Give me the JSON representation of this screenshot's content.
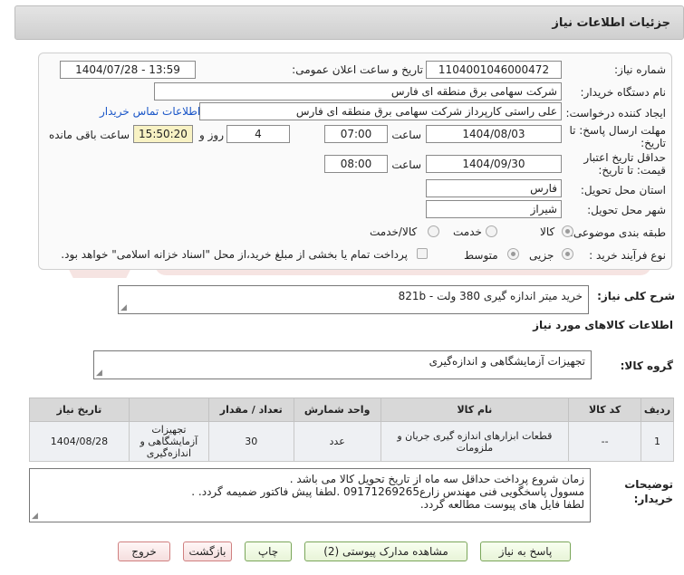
{
  "header": {
    "title": "جزئیات اطلاعات نیاز"
  },
  "form": {
    "need_number_label": "شماره نیاز:",
    "need_number": "1104001046000472",
    "announce_label": "تاریخ و ساعت اعلان عمومی:",
    "announce_value": "1404/07/28 - 13:59",
    "buyer_org_label": "نام دستگاه خریدار:",
    "buyer_org": "شرکت سهامی برق منطقه ای فارس",
    "creator_label": "ایجاد کننده درخواست:",
    "creator": "علی راستی کارپرداز شرکت سهامی برق منطقه ای فارس",
    "contact_link": "اطلاعات تماس خریدار",
    "deadline_label_1": "مهلت ارسال پاسخ: تا",
    "deadline_label_2": "تاریخ:",
    "deadline_date": "1404/08/03",
    "time_label": "ساعت",
    "deadline_time": "07:00",
    "days_value": "4",
    "days_label": "روز و",
    "remaining_time": "15:50:20",
    "remaining_label": "ساعت باقی مانده",
    "min_validity_label_1": "حداقل تاریخ اعتبار",
    "min_validity_label_2": "قیمت: تا تاریخ:",
    "validity_date": "1404/09/30",
    "validity_time": "08:00",
    "province_label": "استان محل تحویل:",
    "province": "فارس",
    "city_label": "شهر محل تحویل:",
    "city": "شیراز",
    "category_label": "طبقه بندی موضوعی:",
    "category_options": [
      "کالا",
      "خدمت",
      "کالا/خدمت"
    ],
    "process_label": "نوع فرآیند خرید :",
    "process_options": [
      "جزیی",
      "متوسط"
    ],
    "payment_note": "پرداخت تمام یا بخشی از مبلغ خرید،از محل \"اسناد خزانه اسلامی\" خواهد بود."
  },
  "summary": {
    "label": "شرح کلی نیاز:",
    "value": "خرید میتر اندازه گیری 380 ولت - 821b"
  },
  "goods_info": {
    "heading": "اطلاعات کالاهای مورد نیاز",
    "group_label": "گروه کالا:",
    "group_value": "تجهیزات آزمایشگاهی و اندازه‌گیری"
  },
  "table": {
    "headers": [
      "ردیف",
      "کد کالا",
      "نام کالا",
      "واحد شمارش",
      "تعداد / مقدار",
      "تاریخ نیاز"
    ],
    "rows": [
      {
        "row": "1",
        "code": "--",
        "name": "قطعات ابزارهای اندازه گیری جریان و ملزومات",
        "unit": "عدد",
        "qty": "30",
        "need_date": "1404/08/28",
        "group_1": "تجهیزات",
        "group_2": "آزمایشگاهی و",
        "group_3": "اندازه‌گیری"
      }
    ]
  },
  "notes": {
    "label_1": "توضیحات",
    "label_2": "خریدار:",
    "line_1": "زمان شروع پرداخت حداقل سه ماه از تاریخ تحویل کالا می باشد .",
    "line_2": "مسوول پاسخگویی فنی مهندس زارع09171269265 .لطفا پیش فاکتور ضمیمه گردد. .",
    "line_3": "لطفا فایل های پیوست مطالعه گردد."
  },
  "buttons": {
    "reply": "پاسخ به نیاز",
    "attachments": "مشاهده مدارک پیوستی (2)",
    "print": "چاپ",
    "back": "بازگشت",
    "exit": "خروج"
  },
  "watermark": {
    "text": "AriaTender.net"
  },
  "colors": {
    "link": "#1a56c8",
    "button_border": "#7aa65a",
    "exit_border": "#d08080",
    "timer_bg": "#f8f2c4"
  }
}
